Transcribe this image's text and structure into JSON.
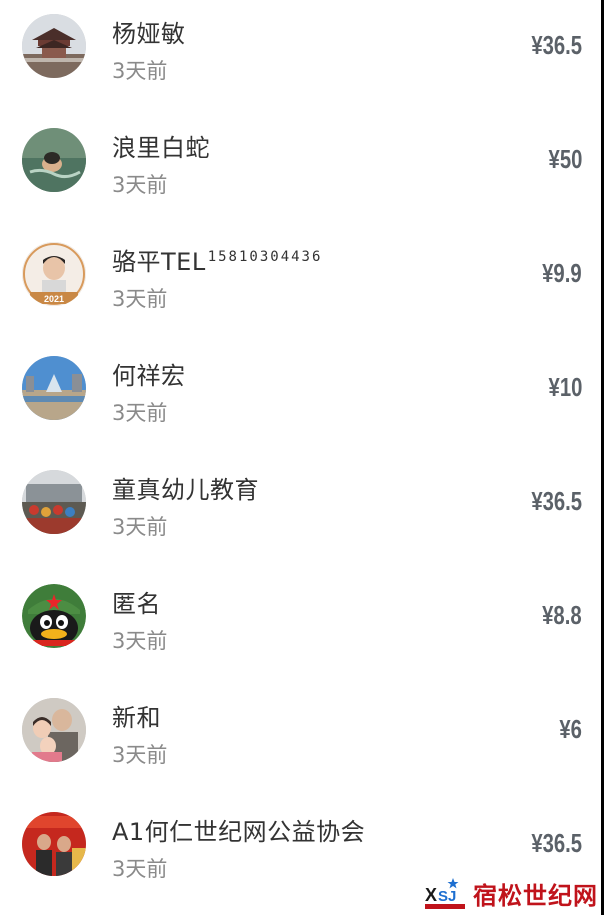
{
  "donations": [
    {
      "name": "杨娅敏",
      "phone": "",
      "time": "3天前",
      "amount": "¥36.5",
      "avatar_icon": "pavilion-photo-avatar"
    },
    {
      "name": "浪里白蛇",
      "phone": "",
      "time": "3天前",
      "amount": "¥50",
      "avatar_icon": "swimmer-photo-avatar"
    },
    {
      "name": "骆平TEL",
      "phone": "15810304436",
      "time": "3天前",
      "amount": "¥9.9",
      "avatar_icon": "portrait-2021-avatar"
    },
    {
      "name": "何祥宏",
      "phone": "",
      "time": "3天前",
      "amount": "¥10",
      "avatar_icon": "fountain-photo-avatar"
    },
    {
      "name": "童真幼儿教育",
      "phone": "",
      "time": "3天前",
      "amount": "¥36.5",
      "avatar_icon": "group-photo-avatar"
    },
    {
      "name": "匿名",
      "phone": "",
      "time": "3天前",
      "amount": "¥8.8",
      "avatar_icon": "penguin-avatar"
    },
    {
      "name": "新和",
      "phone": "",
      "time": "3天前",
      "amount": "¥6",
      "avatar_icon": "family-photo-avatar"
    },
    {
      "name": "A1何仁世纪网公益协会",
      "phone": "",
      "time": "3天前",
      "amount": "¥36.5",
      "avatar_icon": "event-photo-avatar"
    }
  ],
  "watermark": {
    "text": "宿松世纪网",
    "logo_icon": "xsj-logo-icon"
  },
  "colors": {
    "name": "#333333",
    "time": "#8a8a8a",
    "amount": "#5b6168",
    "watermark": "#c0131b"
  }
}
